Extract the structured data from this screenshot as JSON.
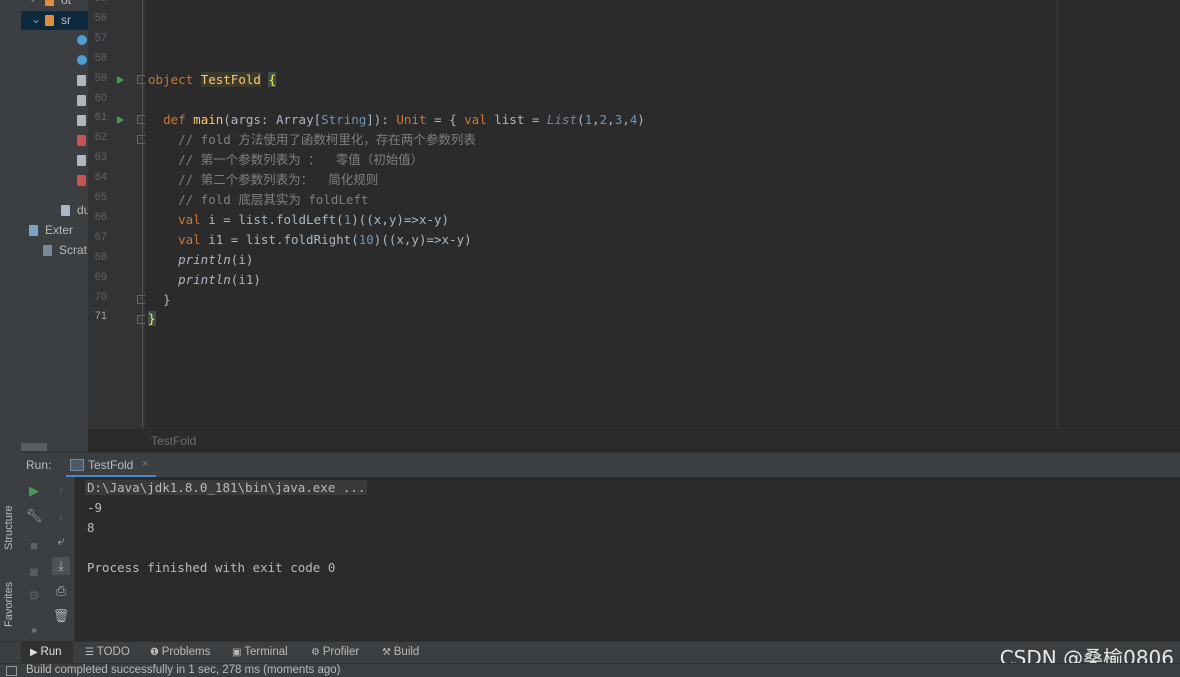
{
  "project_tree": {
    "rows": [
      {
        "label": "ot",
        "icon": "folder-icon",
        "chevron": "›",
        "selected": false
      },
      {
        "label": "sr",
        "icon": "folder-icon",
        "chevron": "⌄",
        "selected": true
      },
      {
        "label": "",
        "icon": "scala-class-icon",
        "chevron": "",
        "selected": false
      },
      {
        "label": "",
        "icon": "scala-class-icon",
        "chevron": "",
        "selected": false
      },
      {
        "label": "",
        "icon": "scala-object-icon",
        "chevron": "",
        "selected": false
      },
      {
        "label": "",
        "icon": "scala-object-icon",
        "chevron": "",
        "selected": false
      },
      {
        "label": "",
        "icon": "scala-object-icon",
        "chevron": "",
        "selected": false
      },
      {
        "label": "",
        "icon": "scala-error-icon",
        "chevron": "",
        "selected": false
      },
      {
        "label": "",
        "icon": "scala-object-icon",
        "chevron": "",
        "selected": false
      },
      {
        "label": "",
        "icon": "scala-error-icon",
        "chevron": "",
        "selected": false
      },
      {
        "label": "du",
        "icon": "module-file-icon",
        "chevron": "",
        "selected": false
      },
      {
        "label": "Exter",
        "icon": "libraries-icon",
        "chevron": "›",
        "selected": false
      },
      {
        "label": "Scrat",
        "icon": "scratches-icon",
        "chevron": "",
        "selected": false
      }
    ]
  },
  "side_tabs": {
    "structure": "Structure",
    "favorites": "Favorites"
  },
  "editor": {
    "line_numbers": [
      "55",
      "56",
      "57",
      "58",
      "59",
      "60",
      "61",
      "62",
      "63",
      "64",
      "65",
      "66",
      "67",
      "68",
      "69",
      "70",
      "71"
    ],
    "current_line": "71",
    "lines": {
      "l59": {
        "kw": "object",
        "name": "TestFold",
        "brace": "{"
      },
      "l61": {
        "kw_def": "def",
        "fn": "main",
        "p1": "(args: Array[",
        "type": "String",
        "p2": "]): ",
        "unit": "Unit",
        "p3": " = { ",
        "kw_val": "val",
        "p4": " list = ",
        "list": "List",
        "p5": "(",
        "n1": "1",
        "c1": ",",
        "n2": "2",
        "c2": ",",
        "n3": "3",
        "c3": ",",
        "n4": "4",
        "p6": ")"
      },
      "l62": "// fold 方法使用了函数柯里化，存在两个参数列表",
      "l63": "// 第一个参数列表为 ：  零值（初始值）",
      "l64": "// 第二个参数列表为：  简化规则",
      "l65": "// fold 底层其实为 foldLeft",
      "l66": {
        "kw": "val",
        "a": " i = list.foldLeft(",
        "n": "1",
        "b": ")((x,y)=>x-y)"
      },
      "l67": {
        "kw": "val",
        "a": " i1 = list.foldRight(",
        "n": "10",
        "b": ")((x,y)=>x-y)"
      },
      "l68": {
        "fn": "println",
        "arg": "(i)"
      },
      "l69": {
        "fn": "println",
        "arg": "(i1)"
      },
      "l70": "}",
      "l71": "}"
    }
  },
  "breadcrumb": "TestFold",
  "run_window": {
    "label": "Run:",
    "tab_label": "TestFold",
    "tab_close": "×",
    "console": {
      "command": "D:\\Java\\jdk1.8.0_181\\bin\\java.exe ...",
      "output": [
        "-9",
        "8",
        "",
        "Process finished with exit code 0"
      ]
    }
  },
  "bottom_tabs": [
    {
      "label": "Run",
      "icon": "run-icon",
      "glyph": "▶",
      "active": true
    },
    {
      "label": "TODO",
      "icon": "todo-icon",
      "glyph": "☰",
      "active": false
    },
    {
      "label": "Problems",
      "icon": "problems-icon",
      "glyph": "❶",
      "active": false
    },
    {
      "label": "Terminal",
      "icon": "terminal-icon",
      "glyph": "▣",
      "active": false
    },
    {
      "label": "Profiler",
      "icon": "profiler-icon",
      "glyph": "⚙",
      "active": false
    },
    {
      "label": "Build",
      "icon": "build-icon",
      "glyph": "⚒",
      "active": false
    }
  ],
  "status_bar": {
    "text": "Build completed successfully in 1 sec, 278 ms (moments ago)"
  },
  "watermark": "CSDN @桑榆0806",
  "colors": {
    "keyword": "#cc7832",
    "function": "#ffc66d",
    "number": "#6897bb",
    "comment": "#808080",
    "accent": "#4a88c7"
  }
}
